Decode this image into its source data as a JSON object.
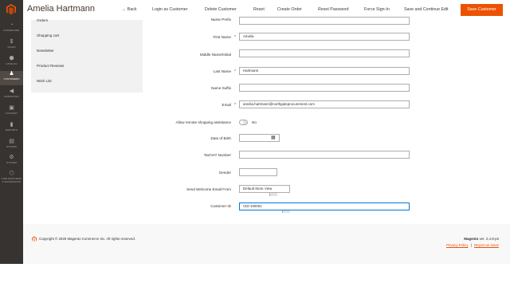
{
  "header": {
    "title": "Amelia Hartmann",
    "buttons": {
      "back": "Back",
      "login_as_customer": "Login as Customer",
      "delete_customer": "Delete Customer",
      "reset": "Reset",
      "create_order": "Create Order",
      "reset_password": "Reset Password",
      "force_sign_in": "Force Sign-In",
      "save_and_continue": "Save and Continue Edit",
      "save_customer": "Save Customer"
    }
  },
  "nav": {
    "items": [
      {
        "label": "DASHBOARD",
        "icon": "speedometer-icon"
      },
      {
        "label": "SALES",
        "icon": "dollar-icon"
      },
      {
        "label": "CATALOG",
        "icon": "cube-icon"
      },
      {
        "label": "CUSTOMERS",
        "icon": "person-icon"
      },
      {
        "label": "MARKETING",
        "icon": "megaphone-icon"
      },
      {
        "label": "CONTENT",
        "icon": "layout-icon"
      },
      {
        "label": "REPORTS",
        "icon": "bar-chart-icon"
      },
      {
        "label": "STORES",
        "icon": "storefront-icon"
      },
      {
        "label": "SYSTEM",
        "icon": "gear-icon"
      },
      {
        "label": "FIND PARTNERS & EXTENSIONS",
        "icon": "partners-icon"
      }
    ]
  },
  "tabs": {
    "items": [
      "Orders",
      "Shopping cart",
      "Newsletter",
      "Product Reviews",
      "Wish List"
    ]
  },
  "form": {
    "name_prefix_label": "Name Prefix",
    "first_name_label": "First Name",
    "first_name_value": "Amelia",
    "middle_name_label": "Middle Name/Initial",
    "middle_name_value": "",
    "last_name_label": "Last Name",
    "last_name_value": "Hartmann",
    "name_suffix_label": "Name Suffix",
    "name_suffix_value": "",
    "email_label": "Email",
    "email_value": "amelia.hartmann@northgateprocurement.com",
    "remote_assistance_label": "Allow remote shopping assistance",
    "remote_assistance_value": "No",
    "dob_label": "Date of Birth",
    "dob_value": "",
    "taxvat_label": "Tax/VAT Number",
    "taxvat_value": "",
    "gender_label": "Gender",
    "gender_value": "",
    "welcome_from_label": "Send Welcome Email From",
    "welcome_from_value": "Default Store View",
    "customer_id_label": "Customer ID",
    "customer_id_value": "CID-100001"
  },
  "footer": {
    "copyright": "Copyright © 2025 Magento Commerce Inc. All rights reserved.",
    "version_brand": "Magento",
    "version_text": "ver. 2.4.8-p3",
    "privacy_policy": "Privacy Policy",
    "report_issue": "Report an Issue",
    "separator": "|"
  },
  "colors": {
    "nav_bg": "#373330",
    "accent": "#eb5202",
    "required": "#e22626",
    "focus_border": "#007bdb"
  }
}
